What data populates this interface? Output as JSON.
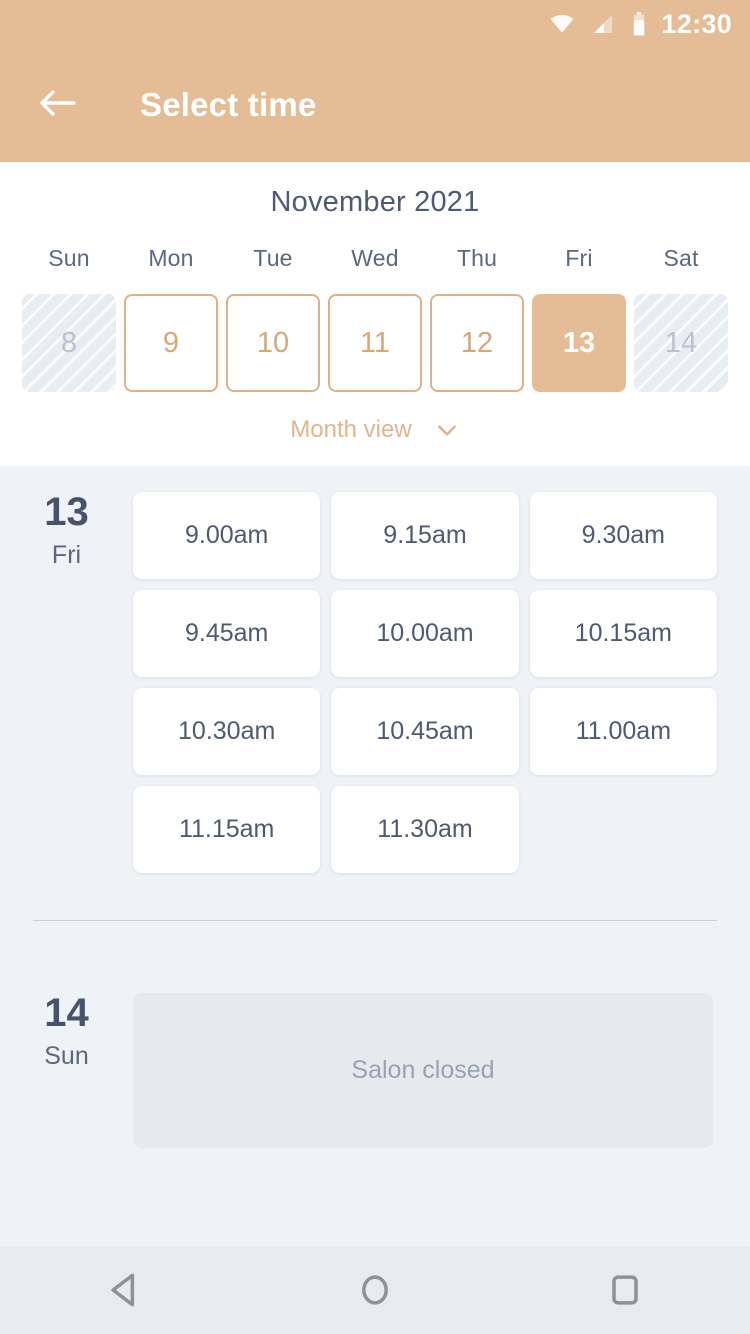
{
  "theme": {
    "accent": "#e4bc95",
    "accent_border": "#ddb287",
    "accent_text": "#d9a874",
    "slate": "#4d5a72",
    "page_bg": "#eff2f7",
    "card_bg": "#ffffff",
    "closed_bg": "#e6e9ee",
    "disabled_bg": "#e8edf4"
  },
  "statusbar": {
    "time": "12:30",
    "icons": [
      "wifi-icon",
      "cellular-signal-icon",
      "battery-icon"
    ]
  },
  "appbar": {
    "back_icon": "arrow-left-icon",
    "title": "Select time"
  },
  "calendar": {
    "month_title": "November 2021",
    "weekdays": [
      "Sun",
      "Mon",
      "Tue",
      "Wed",
      "Thu",
      "Fri",
      "Sat"
    ],
    "dates": [
      {
        "day": "8",
        "state": "disabled"
      },
      {
        "day": "9",
        "state": "available"
      },
      {
        "day": "10",
        "state": "available"
      },
      {
        "day": "11",
        "state": "available"
      },
      {
        "day": "12",
        "state": "available"
      },
      {
        "day": "13",
        "state": "selected"
      },
      {
        "day": "14",
        "state": "disabled"
      }
    ],
    "month_view_label": "Month view",
    "month_view_icon": "chevron-down-icon"
  },
  "days": [
    {
      "day_number": "13",
      "day_of_week": "Fri",
      "slots": [
        "9.00am",
        "9.15am",
        "9.30am",
        "9.45am",
        "10.00am",
        "10.15am",
        "10.30am",
        "10.45am",
        "11.00am",
        "11.15am",
        "11.30am"
      ]
    },
    {
      "day_number": "14",
      "day_of_week": "Sun",
      "closed_message": "Salon closed"
    }
  ],
  "navbar": {
    "back_icon": "nav-back-triangle-icon",
    "home_icon": "nav-home-circle-icon",
    "recents_icon": "nav-recents-square-icon"
  }
}
